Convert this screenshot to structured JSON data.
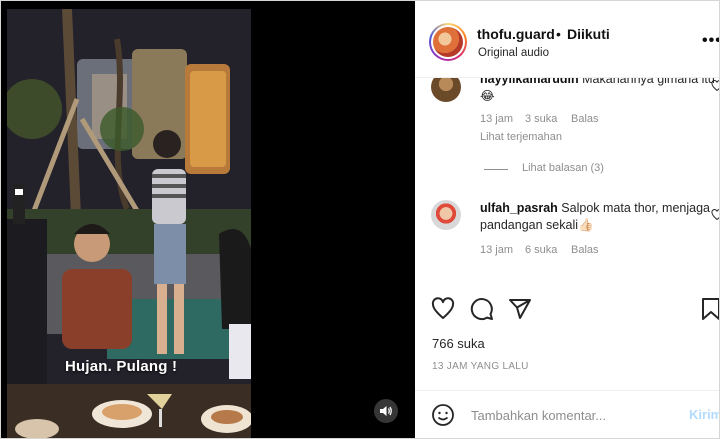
{
  "post": {
    "caption_overlay": "Hujan. Pulang !"
  },
  "header": {
    "username": "thofu.guard",
    "separator": "•",
    "follow_state": "Diikuti",
    "audio": "Original audio",
    "more_icon": "more-icon"
  },
  "comments": [
    {
      "username": "hayyiikamarudin",
      "text": "Makanannya gimana itu😂",
      "time": "13 jam",
      "likes": "3 suka",
      "reply": "Balas",
      "translate": "Lihat terjemahan",
      "view_replies": "Lihat balasan (3)"
    },
    {
      "username": "ulfah_pasrah",
      "text": "Salpok mata thor, menjaga pandangan sekali👍🏻",
      "time": "13 jam",
      "likes": "6 suka",
      "reply": "Balas"
    }
  ],
  "actions": {
    "like_icon": "heart-icon",
    "comment_icon": "comment-icon",
    "share_icon": "share-icon",
    "save_icon": "bookmark-icon"
  },
  "likes_count": "766 suka",
  "timestamp": "13 JAM YANG LALU",
  "composer": {
    "emoji_icon": "emoji-icon",
    "placeholder": "Tambahkan komentar...",
    "send_label": "Kirim"
  },
  "colors": {
    "text": "#262626",
    "muted": "#8e8e8e",
    "send_disabled": "#b3dbff",
    "media_bg": "#000000"
  }
}
